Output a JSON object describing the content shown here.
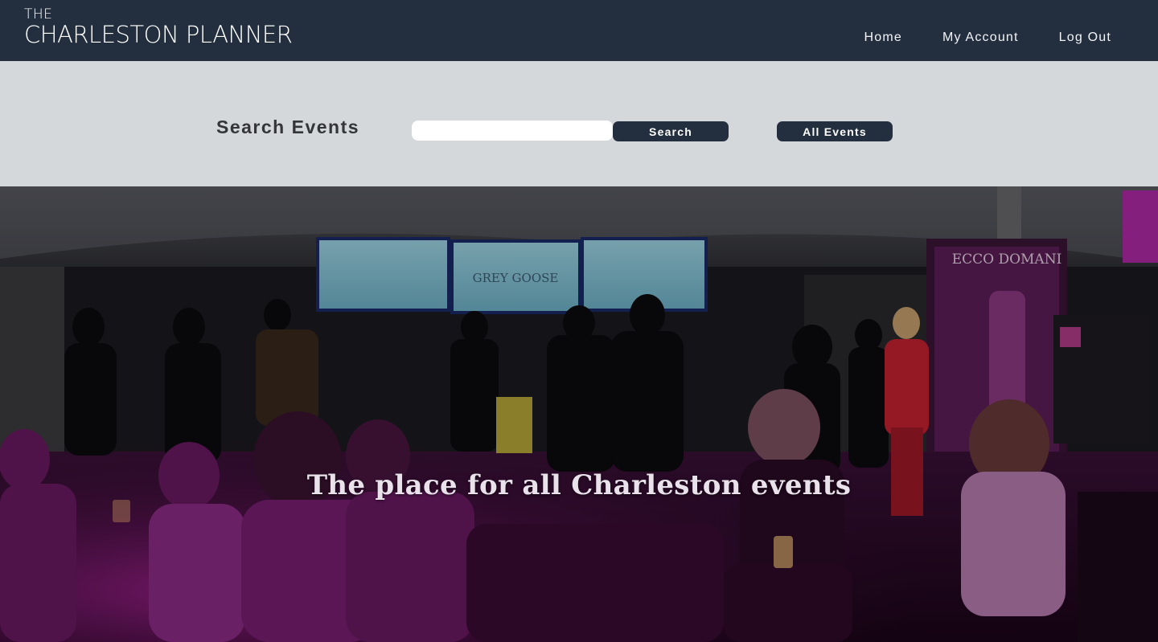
{
  "brand": {
    "logo_top": "THE",
    "logo_main": "CHARLESTON PLANNER"
  },
  "nav": {
    "home": "Home",
    "account": "My Account",
    "logout": "Log Out"
  },
  "search": {
    "title": "Search Events",
    "input_value": "",
    "input_placeholder": "",
    "search_label": "Search",
    "all_events_label": "All Events"
  },
  "hero": {
    "tagline": "The place for all Charleston events",
    "screen_text": "GREY GOOSE",
    "banner_text": "ECCO DOMANI"
  },
  "colors": {
    "navbar": "#232f3f",
    "search_band": "#d5d8db",
    "button": "#232f3f",
    "hero_magenta": "#a2219b"
  }
}
